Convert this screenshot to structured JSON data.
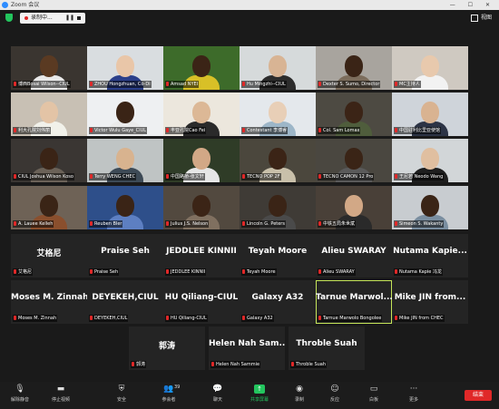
{
  "window": {
    "title": "Zoom 会议",
    "controls": "—  ☐  ✕"
  },
  "recording": {
    "label": "录制中...",
    "pause": "❚❚"
  },
  "view_label": "视图",
  "colors": {
    "accent_green": "#23c55e",
    "record_red": "#e02828",
    "active_border": "#c6e65a"
  },
  "tiles": [
    {
      "name": "博西Bosai Wilson--CIUL",
      "photo": "#3a3530",
      "skin": "#5a3a22",
      "shirt": "#e9e9e9"
    },
    {
      "name": "ZHOU Hongzhuan, Co-Di",
      "photo": "#d9dde0",
      "skin": "#e9c6a8",
      "shirt": "#2b3f8a"
    },
    {
      "name": "Amsad NYEI",
      "photo": "#3d6b2a",
      "skin": "#3b2416",
      "shirt": "#d8c027"
    },
    {
      "name": "Hu Mingzhi--CIUL",
      "photo": "#d6dadb",
      "skin": "#d8b494",
      "shirt": "#2c2c2c"
    },
    {
      "name": "Dexter S. Sumo, Director",
      "photo": "#a8a49e",
      "skin": "#3a2416",
      "shirt": "#7c6d5c"
    },
    {
      "name": "MC主持人",
      "photo": "#cfc9c1",
      "skin": "#e8c9ad",
      "shirt": "#f2f2f2"
    },
    {
      "name": "利大孔院刘伟丽",
      "photo": "#c8c0b4",
      "skin": "#e3c4a6",
      "shirt": "#f1f1ea"
    },
    {
      "name": "Victor Wulu Gaye_CIUL",
      "photo": "#eef0f2",
      "skin": "#3a2416",
      "shirt": "#eaeaea"
    },
    {
      "name": "丰亚孔院Cao Fei",
      "photo": "#ece7dd",
      "skin": "#dcb896",
      "shirt": "#2a2a2a"
    },
    {
      "name": "Contestant 李博睿",
      "photo": "#e4e8ec",
      "skin": "#e8cfb7",
      "shirt": "#9db6c8"
    },
    {
      "name": "Col. Sam Lomax",
      "photo": "#4d4a42",
      "skin": "#3b2416",
      "shirt": "#4f5d3c"
    },
    {
      "name": "中国驻利比里亚使馆",
      "photo": "#cfd4da",
      "skin": "#d9b391",
      "shirt": "#2c3345"
    },
    {
      "name": "CIUL Joshua Wilson Koso",
      "photo": "#3a3633",
      "skin": "#3a2416",
      "shirt": "#6b6258"
    },
    {
      "name": "Terry WENG CHEC",
      "photo": "#bfc4c4",
      "skin": "#d8b38f",
      "shirt": "#3d4a56"
    },
    {
      "name": "中国路桥-张文轩",
      "photo": "#2f3c27",
      "skin": "#d2a886",
      "shirt": "#e6e6e6"
    },
    {
      "name": "TECNO POP 2F",
      "photo": "#4b473d",
      "skin": "#3b2416",
      "shirt": "#c9c0aa"
    },
    {
      "name": "TECNO CAMON 12 Pro",
      "photo": "#4a4740",
      "skin": "#3a2416",
      "shirt": "#5a5a5a"
    },
    {
      "name": "王尼若 Neodo Wang",
      "photo": "#d2d6d8",
      "skin": "#e0bfa0",
      "shirt": "#1e1e1e"
    },
    {
      "name": "A. Lauee Kelleh",
      "photo": "#6e6256",
      "skin": "#3a2416",
      "shirt": "#8a4f2d"
    },
    {
      "name": "Reuben Bler",
      "photo": "#2e4f8a",
      "skin": "#3a2416",
      "shirt": "#5d7fc2"
    },
    {
      "name": "Julius J.S. Nelson",
      "photo": "#52493f",
      "skin": "#3b2416",
      "shirt": "#807060"
    },
    {
      "name": "Lincoln G. Peters",
      "photo": "#3f3b36",
      "skin": "#3a2416",
      "shirt": "#4a4a4a"
    },
    {
      "name": "中铁五局朱世斌",
      "photo": "#494038",
      "skin": "#d2a886",
      "shirt": "#2a2a2a"
    },
    {
      "name": "Simeon S. Wakanty",
      "photo": "#c8ccd0",
      "skin": "#3a2416",
      "shirt": "#7a8ea0"
    }
  ],
  "blank_tiles": [
    {
      "display": "艾格尼",
      "name": "艾格尼"
    },
    {
      "display": "Praise Seh",
      "name": "Praise Seh"
    },
    {
      "display": "JEDDLEE KINNII",
      "name": "JEDDLEE KINNII"
    },
    {
      "display": "Teyah Moore",
      "name": "Teyah Moore"
    },
    {
      "display": "Alieu SWARAY",
      "name": "Alieu SWARAY"
    },
    {
      "display": "Nutama  Kapie...",
      "name": "Nutama Kapie 冯龙"
    },
    {
      "display": "Moses M. Zinnah",
      "name": "Moses M. Zinnah"
    },
    {
      "display": "DEYEKEH,CIUL",
      "name": "DEYEKEH,CIUL"
    },
    {
      "display": "HU Qiliang-CIUL",
      "name": "HU Qiliang-CIUL"
    },
    {
      "display": "Galaxy A32",
      "name": "Galaxy A32"
    },
    {
      "display": "Tarnue  Marwol...",
      "name": "Tarnue Marwolo Bongolee"
    },
    {
      "display": "Mike JIN from...",
      "name": "Mike JIN from CHEC"
    },
    {
      "display": "郭涛",
      "name": "郭涛"
    },
    {
      "display": "Helen  Nah Sam...",
      "name": "Helen  Nah Sammie"
    },
    {
      "display": "Throble Suah",
      "name": "Throble Suah"
    }
  ],
  "toolbar": {
    "mute": "解除静音",
    "video": "停止视频",
    "security": "安全",
    "participants": "参会者",
    "participant_count": "39",
    "chat": "聊天",
    "share": "共享屏幕",
    "record": "录制",
    "reactions": "反应",
    "apps": "应用",
    "whiteboard": "白板",
    "more": "更多",
    "leave": "结束"
  }
}
